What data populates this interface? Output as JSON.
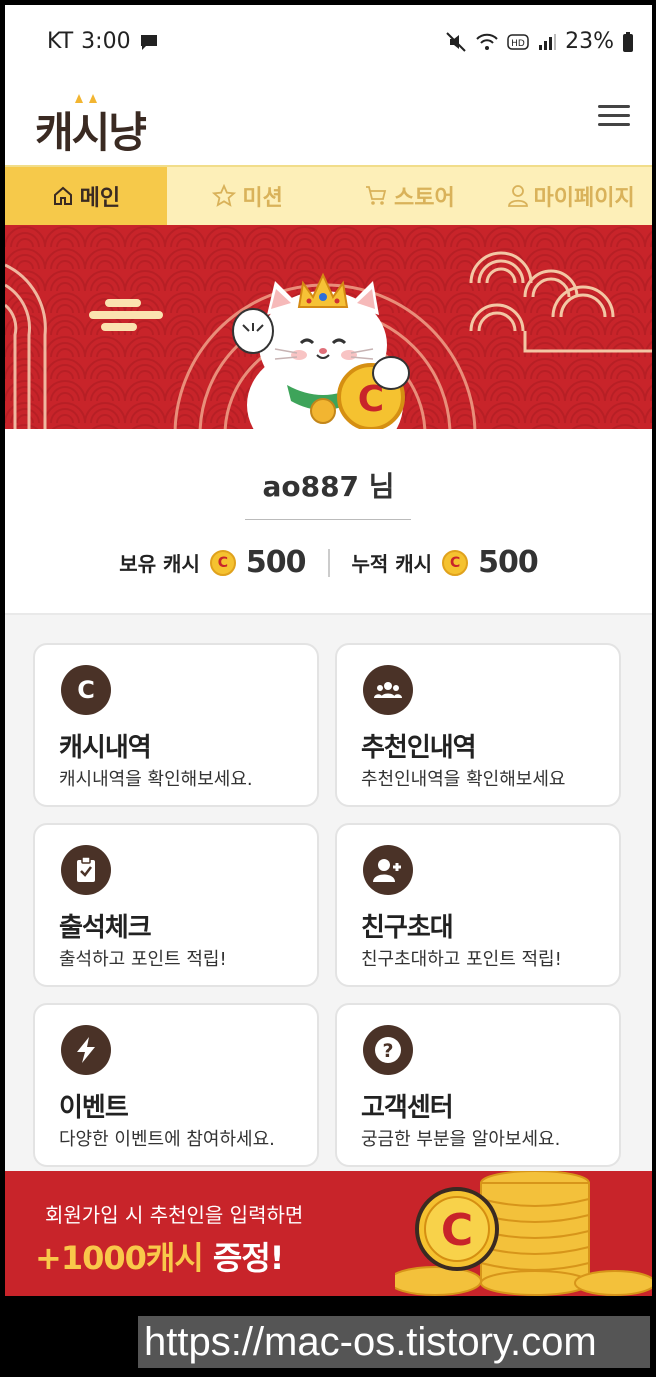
{
  "status_bar": {
    "carrier": "KT",
    "time": "3:00",
    "battery": "23%",
    "icons": [
      "chat-icon",
      "mute-icon",
      "wifi-icon",
      "hd-icon",
      "signal-icon",
      "battery-icon"
    ]
  },
  "header": {
    "logo_text": "캐시냥"
  },
  "tabs": [
    {
      "label": "메인",
      "icon": "home-icon"
    },
    {
      "label": "미션",
      "icon": "star-icon"
    },
    {
      "label": "스토어",
      "icon": "cart-icon"
    },
    {
      "label": "마이페이지",
      "icon": "user-icon"
    }
  ],
  "user": {
    "name": "ao887 님",
    "held_label": "보유 캐시",
    "held_value": "500",
    "total_label": "누적 캐시",
    "total_value": "500",
    "coin_glyph": "C"
  },
  "menu": [
    {
      "title": "캐시내역",
      "desc": "캐시내역을 확인해보세요.",
      "icon": "cash-coin-icon"
    },
    {
      "title": "추천인내역",
      "desc": "추천인내역을 확인해보세요",
      "icon": "group-icon"
    },
    {
      "title": "출석체크",
      "desc": "출석하고 포인트 적립!",
      "icon": "clipboard-check-icon"
    },
    {
      "title": "친구초대",
      "desc": "친구초대하고 포인트 적립!",
      "icon": "add-user-icon"
    },
    {
      "title": "이벤트",
      "desc": "다양한 이벤트에 참여하세요.",
      "icon": "lightning-icon"
    },
    {
      "title": "고객센터",
      "desc": "궁금한 부분을 알아보세요.",
      "icon": "question-icon"
    }
  ],
  "promo": {
    "line1": "회원가입 시 추천인을 입력하면",
    "amount": "+1000캐시",
    "suffix": " 증정!",
    "coin_glyph": "C"
  },
  "watermark": "https://mac-os.tistory.com",
  "colors": {
    "accent_red": "#c8242a",
    "tab_yellow": "#f6c94a",
    "tab_bg": "#fdefb8",
    "icon_brown": "#4a3227",
    "coin_gold": "#f5c230"
  }
}
